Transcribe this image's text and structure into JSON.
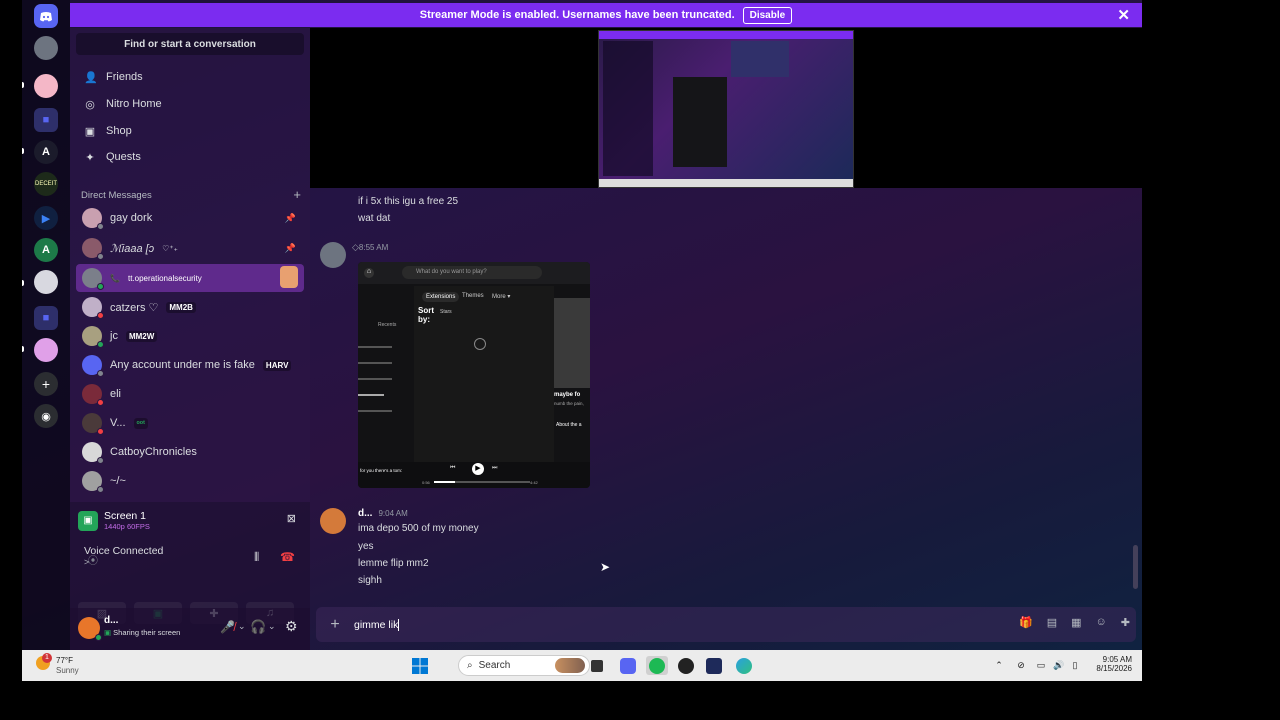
{
  "banner": {
    "text": "Streamer Mode is enabled. Usernames have been truncated.",
    "disable_label": "Disable"
  },
  "sidebar": {
    "search_label": "Find or start a conversation",
    "nav": [
      "Friends",
      "Nitro Home",
      "Shop",
      "Quests"
    ],
    "dm_header": "Direct Messages",
    "dms": [
      {
        "name": "gay dork",
        "tag": ""
      },
      {
        "name": "ℳiaaa [ↄ",
        "tag": "♡⁺₊"
      },
      {
        "name": "tt.operationalsecurity",
        "tag": ""
      },
      {
        "name": "catzers ♡",
        "tag": "MM2B"
      },
      {
        "name": "jc",
        "tag": "MM2W"
      },
      {
        "name": "Any account under me is fake",
        "tag": "HARV"
      },
      {
        "name": "eli",
        "tag": ""
      },
      {
        "name": "V...",
        "tag": "ᵒᵒᵗ"
      },
      {
        "name": "CatboyChronicles",
        "tag": ""
      },
      {
        "name": "~/~",
        "tag": ""
      }
    ]
  },
  "voice": {
    "stream_title": "Screen 1",
    "stream_quality": "1440p 60FPS",
    "status": "Voice Connected",
    "status_sub": ">"
  },
  "user": {
    "name": "d...",
    "status": "Sharing their screen"
  },
  "chat": {
    "msg1_line1": "if i 5x this igu a free 25",
    "msg1_line2": "wat dat",
    "msg2_time": "8:55 AM",
    "embed": {
      "search_placeholder": "What do you want to play?",
      "tab1": "Extensions",
      "tab2": "Themes",
      "tab3": "More ▾",
      "sort": "Sort by:",
      "sort_value": "Stars",
      "recents": "Recents",
      "card_title": "maybe fo",
      "card_sub": "numb the pain,",
      "about": "About the a",
      "now_playing": "for you there's a tom:",
      "time_start": "0:56",
      "time_end": "4:42"
    },
    "msg3_author": "d...",
    "msg3_time": "9:04 AM",
    "msg3_lines": [
      "ima depo 500 of my money",
      "yes",
      "lemme flip mm2",
      "sighh"
    ],
    "input_value": "gimme lik"
  },
  "taskbar": {
    "weather_temp": "77°F",
    "weather_desc": "Sunny",
    "weather_badge": "1",
    "search": "Search",
    "time": "9:05 AM",
    "date": "8/15/2026"
  },
  "colors": {
    "accent": "#7b2cf0",
    "online": "#23a559",
    "dnd": "#f23f43",
    "idle": "#f0b232"
  }
}
